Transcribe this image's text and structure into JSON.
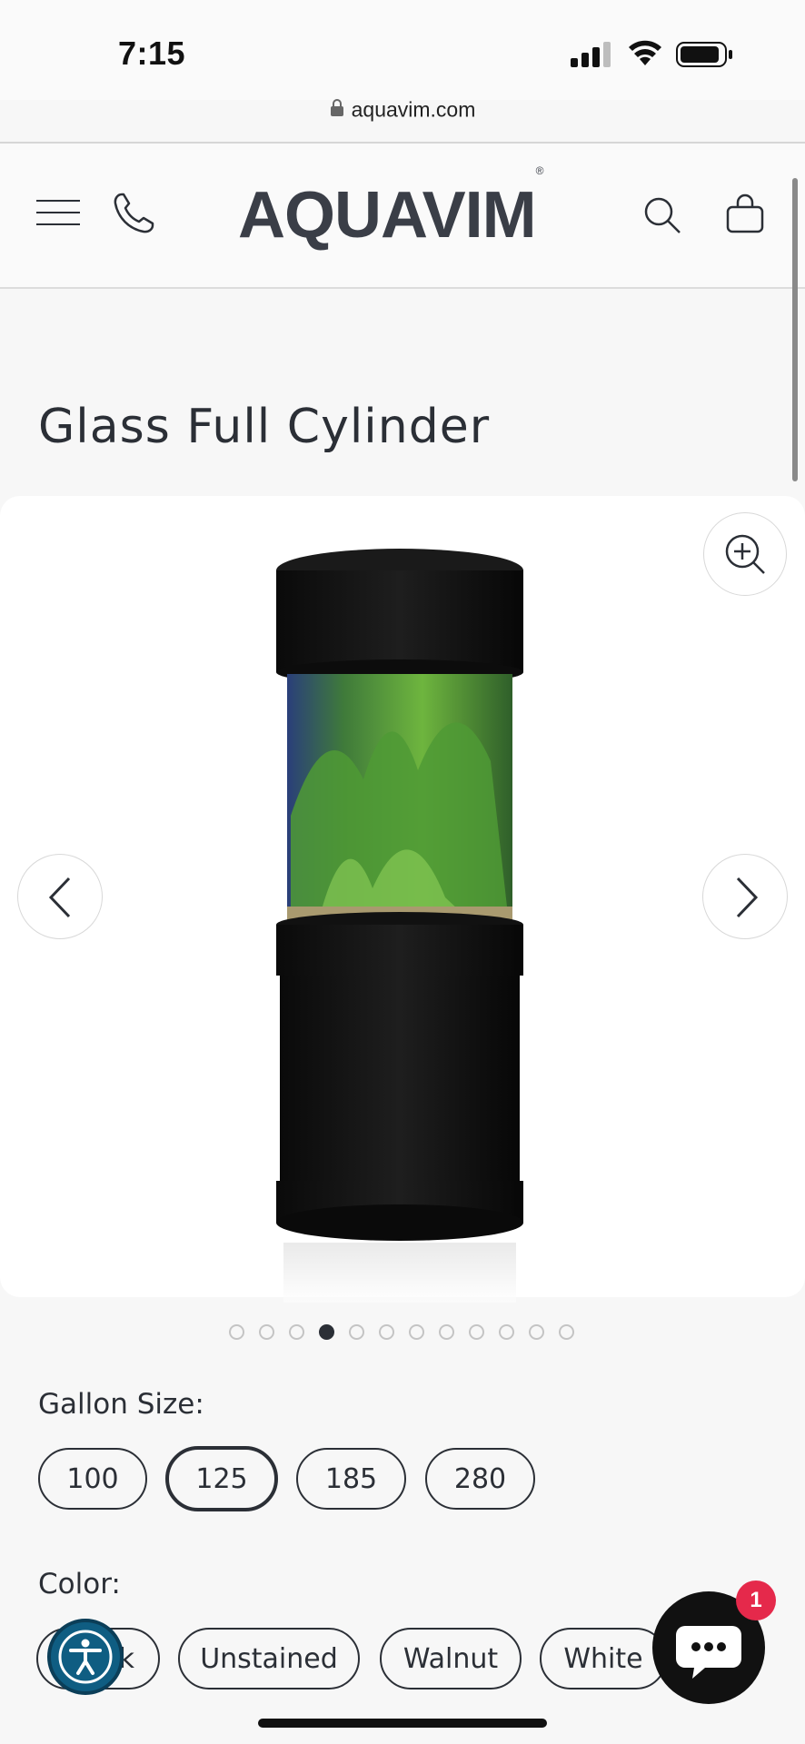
{
  "status_bar": {
    "time": "7:15",
    "url": "aquavim.com"
  },
  "header": {
    "logo": "AQUAVIM",
    "logo_mark": "®",
    "icons": [
      "menu-icon",
      "phone-icon",
      "search-icon",
      "bag-icon"
    ]
  },
  "product": {
    "title": "Glass Full Cylinder",
    "gallery": {
      "image_description": "black cylinder aquarium on stand",
      "total_images": 12,
      "active_index": 4
    }
  },
  "options": {
    "gallon": {
      "label": "Gallon Size:",
      "values": [
        "100",
        "125",
        "185",
        "280"
      ],
      "selected": "125"
    },
    "color": {
      "label": "Color:",
      "values": [
        "Black",
        "Unstained",
        "Walnut",
        "White"
      ],
      "visible_first_fragment": "k"
    }
  },
  "chat": {
    "badge_count": "1"
  },
  "colors": {
    "text": "#2b2f36",
    "accessibility": "#0f5d82",
    "chat_badge": "#e5294b"
  }
}
